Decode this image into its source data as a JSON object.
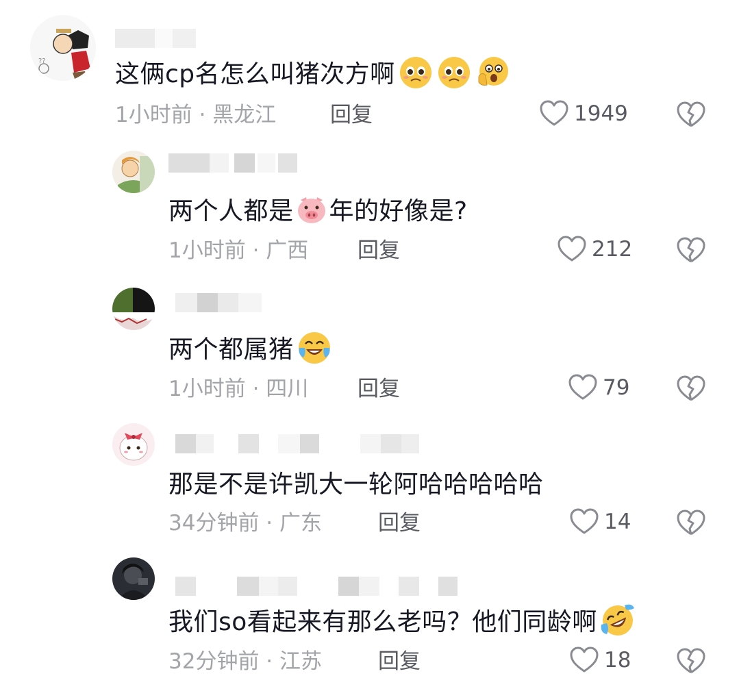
{
  "comments": [
    {
      "text": "这俩cp名怎么叫猪次方啊",
      "emojis": [
        "pleading-face",
        "pleading-face",
        "shocked-face"
      ],
      "time": "1小时前",
      "location": "黑龙江",
      "reply_label": "回复",
      "likes": "1949"
    },
    {
      "text_before": "两个人都是",
      "emoji_mid": "pig-face",
      "text_after": "年的好像是?",
      "time": "1小时前",
      "location": "广西",
      "reply_label": "回复",
      "likes": "212"
    },
    {
      "text": "两个都属猪",
      "emojis": [
        "laughing-tears-face"
      ],
      "time": "1小时前",
      "location": "四川",
      "reply_label": "回复",
      "likes": "79"
    },
    {
      "text": "那是不是许凯大一轮阿哈哈哈哈哈",
      "time": "34分钟前",
      "location": "广东",
      "reply_label": "回复",
      "likes": "14"
    },
    {
      "text": "我们so看起来有那么老吗？他们同龄啊",
      "emojis": [
        "rolling-laughing-face"
      ],
      "time": "32分钟前",
      "location": "江苏",
      "reply_label": "回复",
      "likes": "18"
    }
  ],
  "separator": " · ",
  "colors": {
    "text": "#161823",
    "meta": "#a3a4a8",
    "reply": "#5a5b62",
    "icon": "#8a8b91"
  }
}
